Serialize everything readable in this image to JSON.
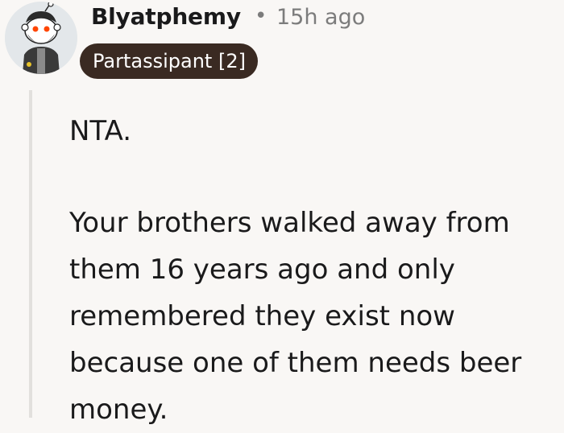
{
  "comment": {
    "author": "Blyatphemy",
    "separator": "•",
    "timestamp": "15h ago",
    "flair": "Partassipant [2]",
    "avatar_icon": "snoo-avatar-icon",
    "paragraphs": [
      "NTA.",
      "Your brothers walked away from them 16 years ago and only remembered they exist now because one of them needs beer money."
    ]
  },
  "colors": {
    "background": "#f9f7f5",
    "flair_bg": "#3a2a22",
    "meta_text": "#7c7c7c",
    "thread_line": "#e2e0dd"
  }
}
